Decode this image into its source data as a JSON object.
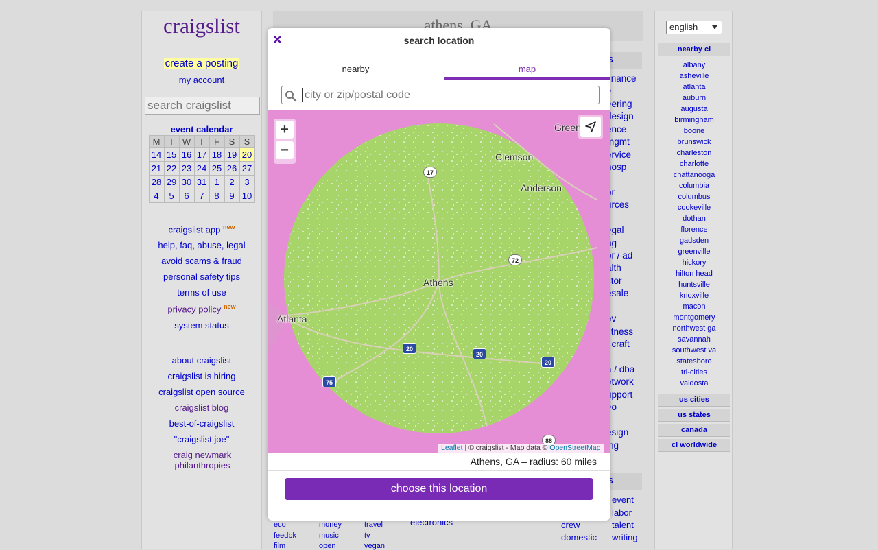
{
  "left": {
    "logo": "craigslist",
    "create_posting": "create a posting",
    "my_account": "my account",
    "search_placeholder": "search craigslist",
    "calendar_title": "event calendar",
    "calendar_days": [
      "M",
      "T",
      "W",
      "T",
      "F",
      "S",
      "S"
    ],
    "calendar_rows": [
      [
        "14",
        "15",
        "16",
        "17",
        "18",
        "19",
        "20"
      ],
      [
        "21",
        "22",
        "23",
        "24",
        "25",
        "26",
        "27"
      ],
      [
        "28",
        "29",
        "30",
        "31",
        "1",
        "2",
        "3"
      ],
      [
        "4",
        "5",
        "6",
        "7",
        "8",
        "9",
        "10"
      ]
    ],
    "links1": [
      "craigslist app",
      "help, faq, abuse, legal",
      "avoid scams & fraud",
      "personal safety tips",
      "terms of use",
      "privacy policy",
      "system status"
    ],
    "new_badge": "new",
    "links2": [
      "about craigslist",
      "craigslist is hiring",
      "craigslist open source",
      "craigslist blog",
      "best-of-craigslist",
      "\"craigslist joe\"",
      "craig newmark philanthropies"
    ]
  },
  "center": {
    "area_title": "athens, GA",
    "jobs_head": "s",
    "gigs_head": "s",
    "jobs_fragments": [
      "finance",
      "e",
      "eering",
      "design",
      "ence",
      "mgmt",
      "ervice",
      "hosp",
      "or",
      "urces",
      "egal",
      "ng",
      "pr / ad",
      "alth",
      "ctor",
      "esale",
      "ev",
      "fitness",
      "/ craft",
      "a / dba",
      "etwork",
      "upport",
      "eo",
      "esign",
      "ing"
    ],
    "bottom_left": [
      "eco",
      "feedbk",
      "film"
    ],
    "bottom_mid1": [
      "money",
      "music",
      "open"
    ],
    "bottom_mid2": [
      "travel",
      "tv",
      "vegan"
    ],
    "bottom_electronics": "electronics",
    "gigs_col1": [
      "crew",
      "domestic"
    ],
    "gigs_col2": [
      "event",
      "labor",
      "talent",
      "writing"
    ]
  },
  "right": {
    "language": "english",
    "nearby_head": "nearby cl",
    "nearby": [
      "albany",
      "asheville",
      "atlanta",
      "auburn",
      "augusta",
      "birmingham",
      "boone",
      "brunswick",
      "charleston",
      "charlotte",
      "chattanooga",
      "columbia",
      "columbus",
      "cookeville",
      "dothan",
      "florence",
      "gadsden",
      "greenville",
      "hickory",
      "hilton head",
      "huntsville",
      "knoxville",
      "macon",
      "montgomery",
      "northwest ga",
      "savannah",
      "southwest va",
      "statesboro",
      "tri-cities",
      "valdosta"
    ],
    "us_cities": "us cities",
    "us_states": "us states",
    "canada": "canada",
    "cl_worldwide": "cl worldwide"
  },
  "modal": {
    "title": "search location",
    "close": "×",
    "tab_nearby": "nearby",
    "tab_map": "map",
    "input_placeholder": "city or zip/postal code",
    "zoom_in": "+",
    "zoom_out": "−",
    "attribution_leaflet": "Leaflet",
    "attribution_mid": " | © craigslist - Map data © ",
    "attribution_osm": "OpenStreetMap",
    "map_labels": {
      "greenville": "Greenville",
      "clemson": "Clemson",
      "anderson": "Anderson",
      "athens": "Athens",
      "atlanta": "Atlanta"
    },
    "shields": [
      "17",
      "72",
      "20",
      "20",
      "20",
      "75",
      "88"
    ],
    "radius_text": "Athens, GA – radius: 60 miles",
    "radius_miles": 60,
    "choose_button": "choose this location",
    "colors": {
      "accent": "#7a2bb6",
      "radius_fill": "#a8d56a",
      "map_outside": "#e58ed6"
    }
  }
}
